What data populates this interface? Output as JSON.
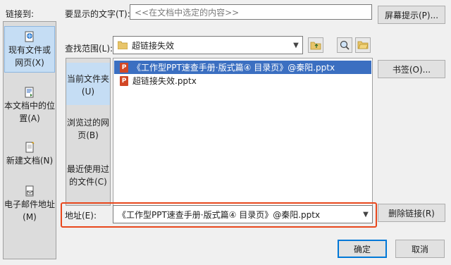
{
  "link_to": {
    "label": "链接到:",
    "items": [
      {
        "label": "现有文件或网页(X)",
        "selected": true,
        "icon": "web-page-icon"
      },
      {
        "label": "本文档中的位置(A)",
        "selected": false,
        "icon": "document-place-icon"
      },
      {
        "label": "新建文档(N)",
        "selected": false,
        "icon": "new-document-icon"
      },
      {
        "label": "电子邮件地址(M)",
        "selected": false,
        "icon": "email-icon"
      }
    ]
  },
  "display_text": {
    "label": "要显示的文字(T):",
    "value": "<<在文档中选定的内容>>"
  },
  "screentip_button": "屏幕提示(P)...",
  "look_in": {
    "label": "查找范围(L):",
    "value": "超链接失效"
  },
  "locations": [
    {
      "label": "当前文件夹(U)",
      "selected": true
    },
    {
      "label": "浏览过的网页(B)",
      "selected": false
    },
    {
      "label": "最近使用过的文件(C)",
      "selected": false
    }
  ],
  "files": [
    {
      "name": "《工作型PPT速查手册·版式篇④ 目录页》@秦阳.pptx",
      "selected": true
    },
    {
      "name": "超链接失效.pptx",
      "selected": false
    }
  ],
  "bookmark_button": "书签(O)...",
  "address": {
    "label": "地址(E):",
    "value": "《工作型PPT速查手册·版式篇④ 目录页》@秦阳.pptx"
  },
  "remove_link_button": "删除链接(R)",
  "ok_button": "确定",
  "cancel_button": "取消",
  "colors": {
    "highlight_border": "#e8471c",
    "selection": "#3b6fc1",
    "pptx_icon": "#d24726"
  }
}
